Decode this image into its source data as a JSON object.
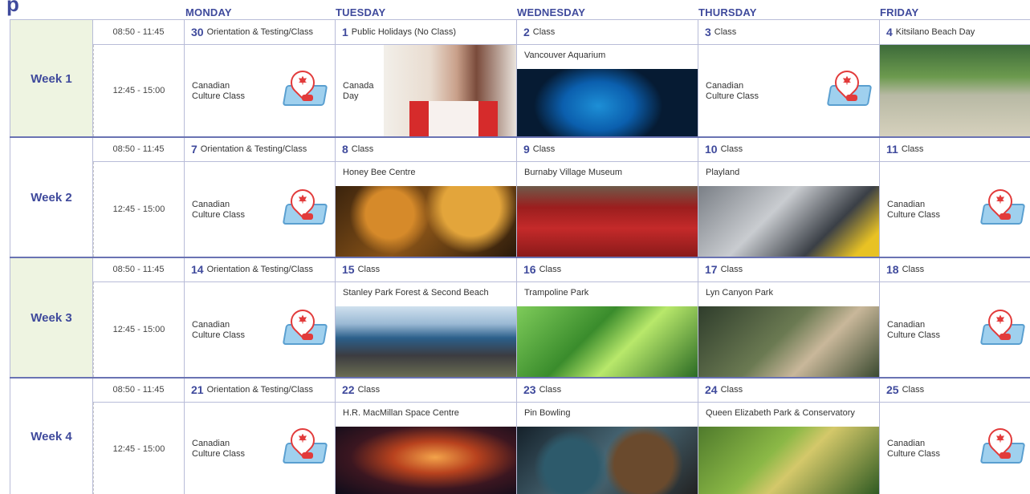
{
  "days": [
    "MONDAY",
    "TUESDAY",
    "WEDNESDAY",
    "THURSDAY",
    "FRIDAY"
  ],
  "weeks": [
    {
      "label": "Week 1",
      "morning_time": "08:50 - 11:45",
      "afternoon_time": "12:45 - 15:00",
      "morning": [
        {
          "num": "30",
          "text": "Orientation & Testing/Class"
        },
        {
          "num": "1",
          "text": "Public Holidays (No Class)"
        },
        {
          "num": "2",
          "text": "Class"
        },
        {
          "num": "3",
          "text": "Class"
        },
        {
          "num": "4",
          "text": "Kitsilano Beach Day"
        }
      ],
      "afternoon": [
        {
          "type": "culture",
          "line1": "Canadian",
          "line2": "Culture Class"
        },
        {
          "type": "holiday",
          "line1": "Canada",
          "line2": "Day",
          "photo": "students-holding-canadian-flag"
        },
        {
          "type": "activity",
          "title": "Vancouver Aquarium",
          "photo": "jellyfish-tank"
        },
        {
          "type": "culture",
          "line1": "Canadian",
          "line2": "Culture Class"
        },
        {
          "type": "photo",
          "photo": "beach-group-photo"
        }
      ]
    },
    {
      "label": "Week 2",
      "morning_time": "08:50 - 11:45",
      "afternoon_time": "12:45 - 15:00",
      "morning": [
        {
          "num": "7",
          "text": "Orientation & Testing/Class"
        },
        {
          "num": "8",
          "text": "Class"
        },
        {
          "num": "9",
          "text": "Class"
        },
        {
          "num": "10",
          "text": "Class"
        },
        {
          "num": "11",
          "text": "Class"
        }
      ],
      "afternoon": [
        {
          "type": "culture",
          "line1": "Canadian",
          "line2": "Culture Class"
        },
        {
          "type": "activity",
          "title": "Honey Bee Centre",
          "photo": "bees-on-honeycomb"
        },
        {
          "type": "activity",
          "title": "Burnaby Village Museum",
          "photo": "group-on-red-tram"
        },
        {
          "type": "activity",
          "title": "Playland",
          "photo": "bumper-cars"
        },
        {
          "type": "culture",
          "line1": "Canadian",
          "line2": "Culture Class"
        }
      ]
    },
    {
      "label": "Week 3",
      "morning_time": "08:50 - 11:45",
      "afternoon_time": "12:45 - 15:00",
      "morning": [
        {
          "num": "14",
          "text": "Orientation & Testing/Class"
        },
        {
          "num": "15",
          "text": "Class"
        },
        {
          "num": "16",
          "text": "Class"
        },
        {
          "num": "17",
          "text": "Class"
        },
        {
          "num": "18",
          "text": "Class"
        }
      ],
      "afternoon": [
        {
          "type": "culture",
          "line1": "Canadian",
          "line2": "Culture Class"
        },
        {
          "type": "activity",
          "title": "Stanley Park Forest & Second Beach",
          "photo": "seawall-bicycle"
        },
        {
          "type": "activity",
          "title": "Trampoline Park",
          "photo": "foam-pit"
        },
        {
          "type": "activity",
          "title": "Lyn Canyon Park",
          "photo": "friends-on-bridge"
        },
        {
          "type": "culture",
          "line1": "Canadian",
          "line2": "Culture Class"
        }
      ]
    },
    {
      "label": "Week 4",
      "morning_time": "08:50 - 11:45",
      "afternoon_time": "12:45 - 15:00",
      "morning": [
        {
          "num": "21",
          "text": "Orientation & Testing/Class"
        },
        {
          "num": "22",
          "text": "Class"
        },
        {
          "num": "23",
          "text": "Class"
        },
        {
          "num": "24",
          "text": "Class"
        },
        {
          "num": "25",
          "text": "Class"
        }
      ],
      "afternoon": [
        {
          "type": "culture",
          "line1": "Canadian",
          "line2": "Culture Class"
        },
        {
          "type": "activity",
          "title": "H.R. MacMillan Space Centre",
          "photo": "nebula"
        },
        {
          "type": "activity",
          "title": "Pin Bowling",
          "photo": "bowling-balls"
        },
        {
          "type": "activity",
          "title": "Queen Elizabeth Park & Conservatory",
          "photo": "garden"
        },
        {
          "type": "culture",
          "line1": "Canadian",
          "line2": "Culture Class"
        }
      ]
    }
  ],
  "colors": {
    "accent": "#3f4a9c",
    "week_shade": "#eef4e1",
    "grid": "#b8bcd8"
  }
}
